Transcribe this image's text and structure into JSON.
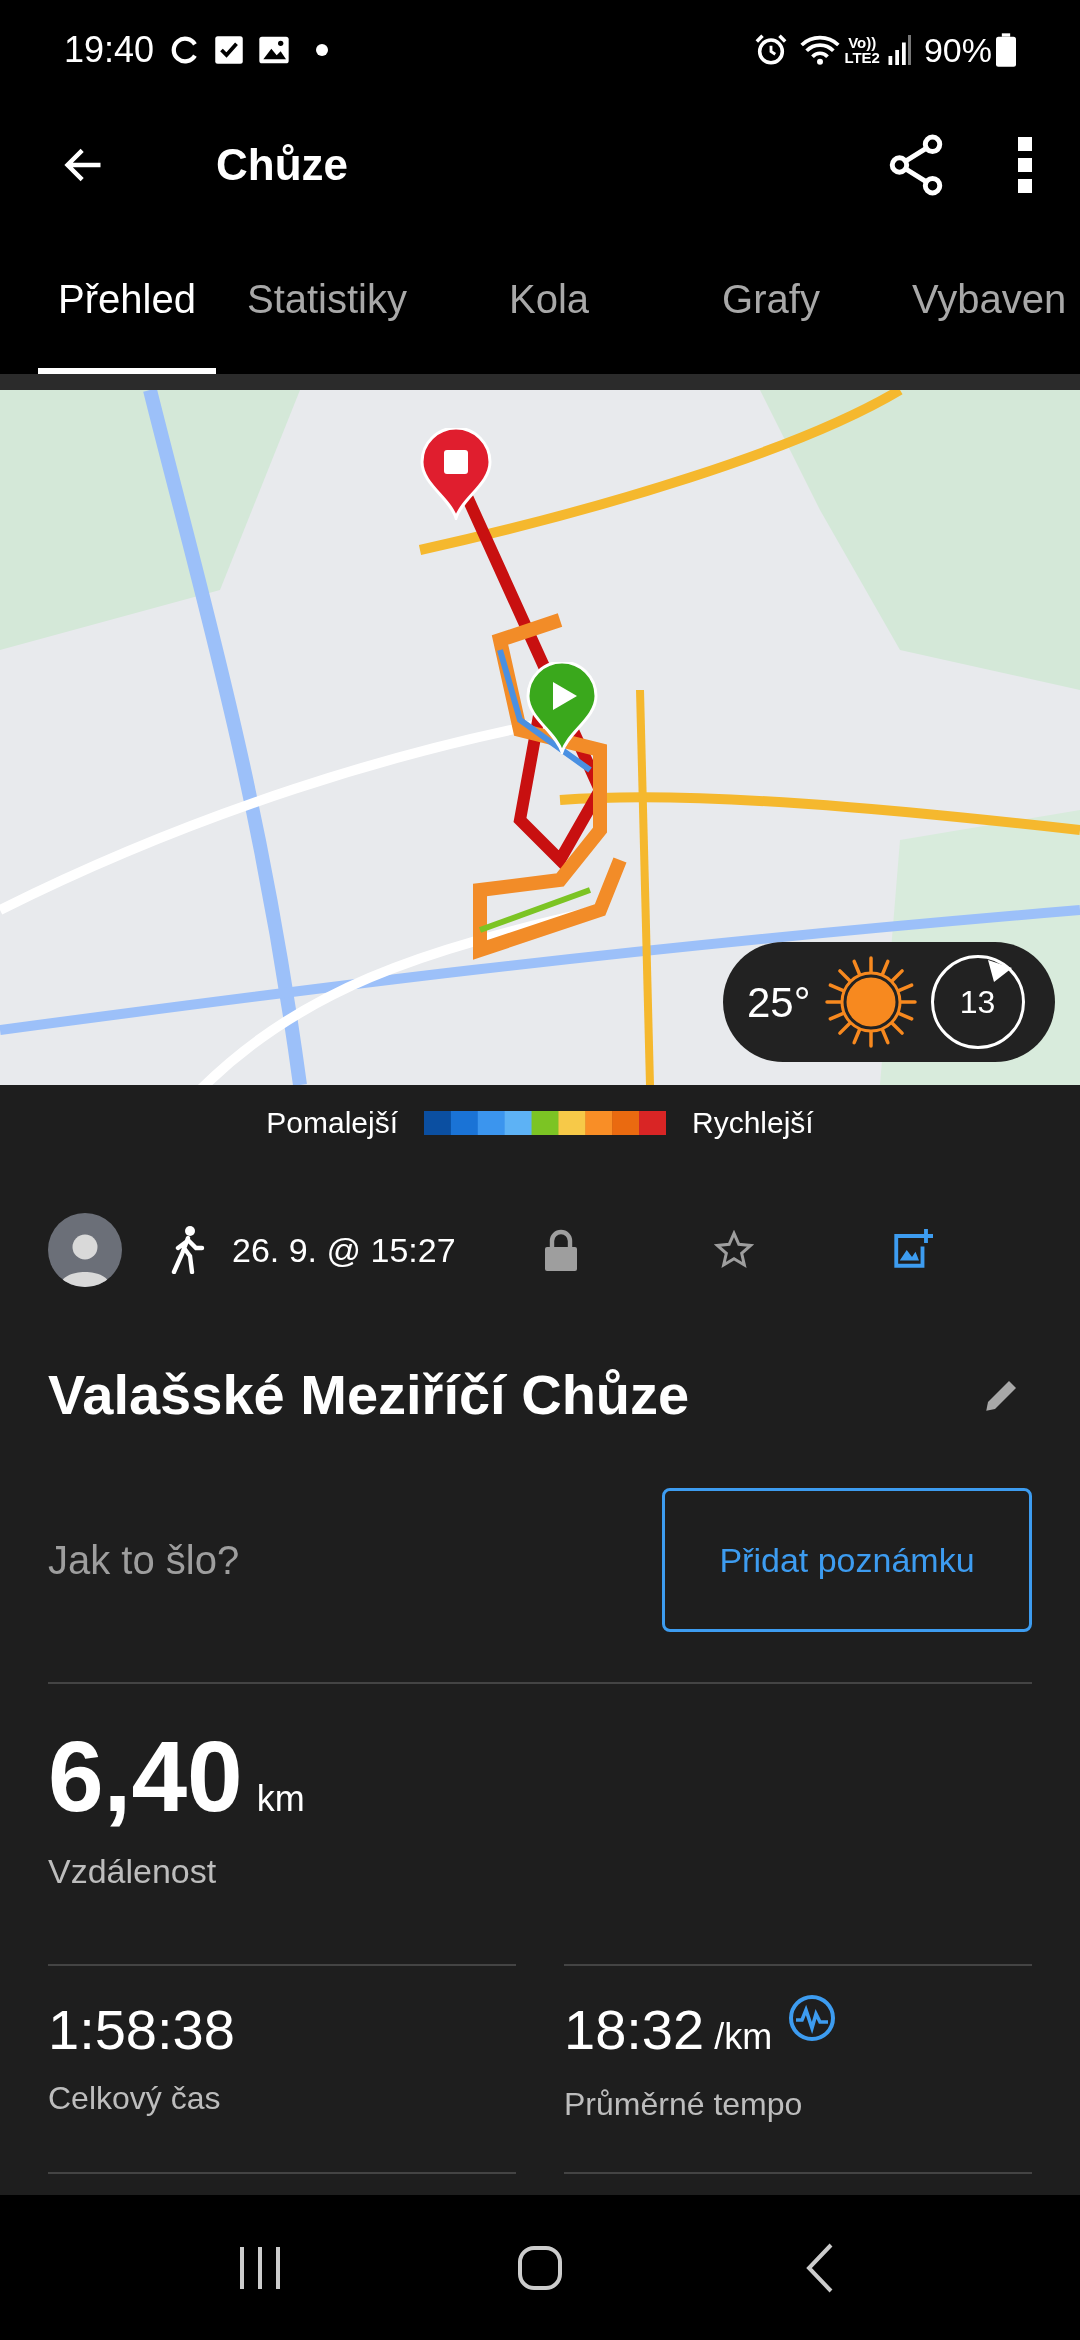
{
  "status_bar": {
    "time": "19:40",
    "volte": "Vo))",
    "network": "LTE2",
    "battery": "90%"
  },
  "header": {
    "title": "Chůze"
  },
  "tabs": [
    {
      "label": "Přehled",
      "selected": true
    },
    {
      "label": "Statistiky",
      "selected": false
    },
    {
      "label": "Kola",
      "selected": false
    },
    {
      "label": "Grafy",
      "selected": false
    },
    {
      "label": "Vybaven",
      "selected": false
    }
  ],
  "map": {
    "kind": "picture",
    "weather": {
      "temperature": "25°",
      "wind": "13"
    }
  },
  "legend": {
    "slower": "Pomalejší",
    "faster": "Rychlejší"
  },
  "activity": {
    "date": "26. 9. @ 15:27",
    "private": true,
    "favorite": false,
    "title": "Valašské Meziříčí Chůze"
  },
  "note": {
    "placeholder": "Jak to šlo?",
    "button": "Přidat poznámku"
  },
  "distance": {
    "value": "6,40",
    "unit": "km",
    "label": "Vzdálenost"
  },
  "stats": [
    {
      "value": "1:58:38",
      "label": "Celkový čas",
      "info": false
    },
    {
      "value": "18:32",
      "unit": "/km",
      "label": "Průměrné tempo",
      "info": true
    }
  ]
}
